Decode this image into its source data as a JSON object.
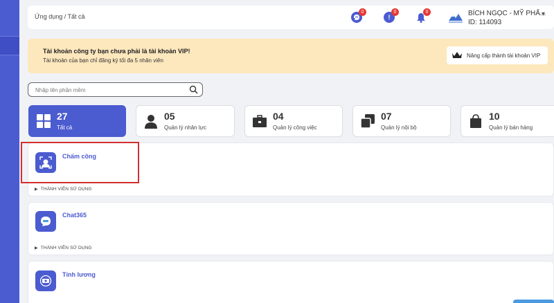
{
  "breadcrumb": "Ứng dụng / Tất cả",
  "header": {
    "notifications": [
      {
        "icon": "chat-icon",
        "count": "0"
      },
      {
        "icon": "alert-icon",
        "count": "0"
      },
      {
        "icon": "bell-icon",
        "count": "0"
      }
    ],
    "company_name": "BÍCH NGỌC - MỸ PHẨ...",
    "company_id": "ID: 114093"
  },
  "vip": {
    "title": "Tài khoản công ty bạn chưa phải là tài khoản VIP!",
    "description": "Tài khoản của bạn chỉ đăng ký tối đa 5 nhân viên",
    "button_label": "Nâng cấp thành tài khoản VIP"
  },
  "search": {
    "placeholder": "Nhập tên phần mềm"
  },
  "categories": [
    {
      "count": "27",
      "label": "Tất cả",
      "icon": "grid-icon"
    },
    {
      "count": "05",
      "label": "Quản lý nhân lực",
      "icon": "person-icon"
    },
    {
      "count": "04",
      "label": "Quản lý công việc",
      "icon": "briefcase-icon"
    },
    {
      "count": "07",
      "label": "Quản lý nội bộ",
      "icon": "copy-icon"
    },
    {
      "count": "10",
      "label": "Quản lý bán hàng",
      "icon": "shopping-bag-icon"
    }
  ],
  "apps": [
    {
      "name": "Chấm công",
      "members_label": "THÀNH VIÊN SỬ DỤNG",
      "icon": "face-scan-icon"
    },
    {
      "name": "Chat365",
      "members_label": "THÀNH VIÊN SỬ DỤNG",
      "icon": "chat365-icon"
    },
    {
      "name": "Tính lương",
      "members_label": "",
      "icon": "payroll-icon"
    }
  ],
  "colors": {
    "primary": "#4b5bd0",
    "banner": "#fde7bd",
    "badge": "#e53935",
    "highlight": "#d32f2f"
  }
}
